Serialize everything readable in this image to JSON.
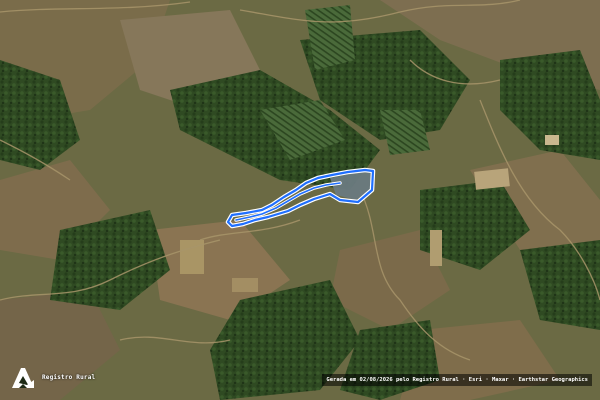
{
  "map": {
    "basemap": "satellite imagery",
    "boundary_color": "#1f6fff",
    "boundary_outline_color": "#ffffff",
    "water_color": "#6a7a80"
  },
  "logo": {
    "icon": "registro-rural-logo-icon",
    "text": "Registro Rural"
  },
  "attribution": {
    "text": "Gerada em 02/08/2026 pelo Registro Rural · Esri · Maxar · Earthstar Geographics"
  }
}
